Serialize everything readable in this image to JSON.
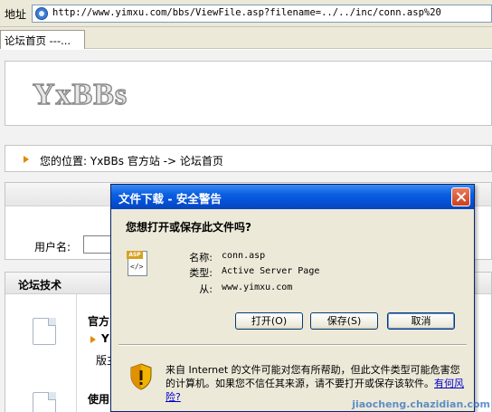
{
  "browser": {
    "address_label": "地址",
    "url": "http://www.yimxu.com/bbs/ViewFile.asp?filename=../../inc/conn.asp%20",
    "tab_label": "论坛首页 ---..."
  },
  "page": {
    "logo": "YxBBs",
    "breadcrumb": "您的位置: YxBBs 官方站 -> 论坛首页",
    "username_label": "用户名:",
    "forum_section_title": "论坛技术",
    "forum_items": [
      "官方",
      "Y",
      "版主",
      "使用"
    ]
  },
  "dialog": {
    "title": "文件下载 - 安全警告",
    "question": "您想打开或保存此文件吗?",
    "file_badge": "ASP",
    "name_label": "名称:",
    "name_value": "conn.asp",
    "type_label": "类型:",
    "type_value": "Active Server Page",
    "from_label": "从:",
    "from_value": "www.yimxu.com",
    "open_button": "打开(O)",
    "save_button": "保存(S)",
    "cancel_button": "取消",
    "warning_text": "来自 Internet 的文件可能对您有所帮助，但此文件类型可能危害您的计算机。如果您不信任其来源，请不要打开或保存该软件。",
    "risk_link": "有何风险?"
  },
  "watermark": "jiaocheng.chazidian.com",
  "colors": {
    "titlebar": "#0a5fe0",
    "dialog_bg": "#ece9d8",
    "breadcrumb_arrow": "#e08a00",
    "link": "#0000cc"
  }
}
